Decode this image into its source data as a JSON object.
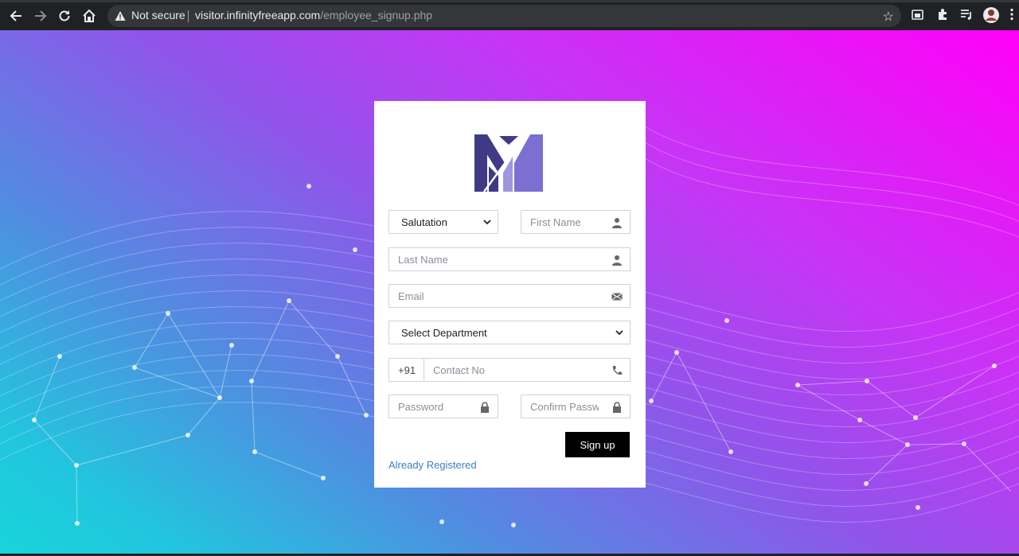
{
  "browser": {
    "security_label": "Not secure",
    "url_host": "visitor.infinityfreeapp.com",
    "url_path": "/employee_signup.php"
  },
  "form": {
    "salutation": "Salutation",
    "first_name_placeholder": "First Name",
    "last_name_placeholder": "Last Name",
    "email_placeholder": "Email",
    "department": "Select Department",
    "phone_prefix": "+91",
    "contact_placeholder": "Contact No",
    "password_placeholder": "Password",
    "confirm_password_placeholder": "Confirm Passw",
    "submit_label": "Sign up",
    "login_link": "Already Registered"
  },
  "colors": {
    "gradient_top_right": "#ff00f8",
    "gradient_bottom_left": "#18d4d9",
    "logo_dark": "#3f3a85",
    "logo_light": "#7b6fd1",
    "button": "#000000",
    "link": "#3b7fc4"
  },
  "icons": [
    "back-arrow-icon",
    "forward-arrow-icon",
    "reload-icon",
    "home-icon",
    "warning-icon",
    "star-icon",
    "extension-icon",
    "puzzle-icon",
    "playlist-icon",
    "profile-avatar-icon",
    "menu-dots-icon",
    "user-icon",
    "envelope-icon",
    "phone-icon",
    "lock-icon",
    "chevron-down-icon"
  ]
}
